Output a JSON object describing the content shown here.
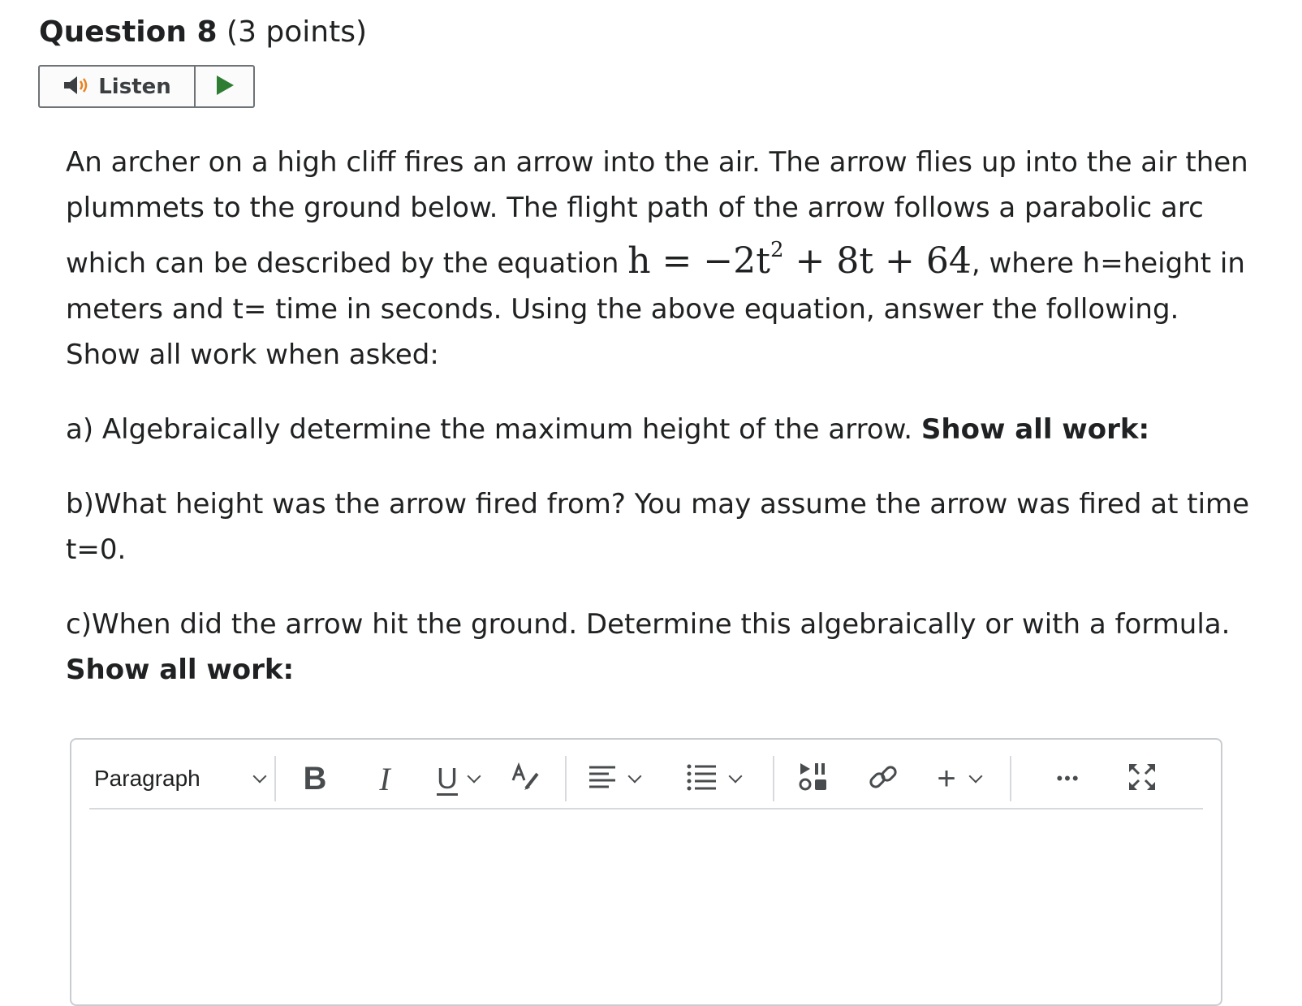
{
  "question": {
    "title": "Question 8",
    "points": "(3 points)"
  },
  "listen": {
    "label": "Listen",
    "speaker_icon": "speaker-icon",
    "play_icon": "play-icon",
    "play_color": "#2f7d32"
  },
  "body": {
    "intro_1": "An archer on a high cliff fires an arrow into the air. The arrow flies up into the air then plummets to the ground below. The flight path of the arrow follows a parabolic arc which can be described by the equation ",
    "equation_lhs": "h = −2t",
    "equation_exp": "2",
    "equation_rhs": " + 8t + 64",
    "intro_2": ", where h=height in meters and t= time in seconds. Using the above equation, answer the following. Show all work when asked:",
    "part_a": "a) Algebraically determine the maximum height of the arrow. ",
    "part_a_bold": "Show all work:",
    "part_b": "b)What height was the arrow fired from? You may assume the arrow was fired at time t=0.",
    "part_c": "c)When did the arrow hit the ground. Determine this algebraically or with a formula. ",
    "part_c_bold": "Show all work:"
  },
  "editor": {
    "block_format": "Paragraph",
    "bold_glyph": "B",
    "italic_glyph": "I",
    "underline_glyph": "U",
    "plus_glyph": "+",
    "more_glyph": "•••",
    "icons": [
      "chevron-down-icon",
      "bold-icon",
      "italic-icon",
      "underline-icon",
      "text-format-icon",
      "align-icon",
      "list-icon",
      "media-icon",
      "link-icon",
      "insert-icon",
      "more-icon",
      "fullscreen-icon"
    ],
    "content": ""
  }
}
